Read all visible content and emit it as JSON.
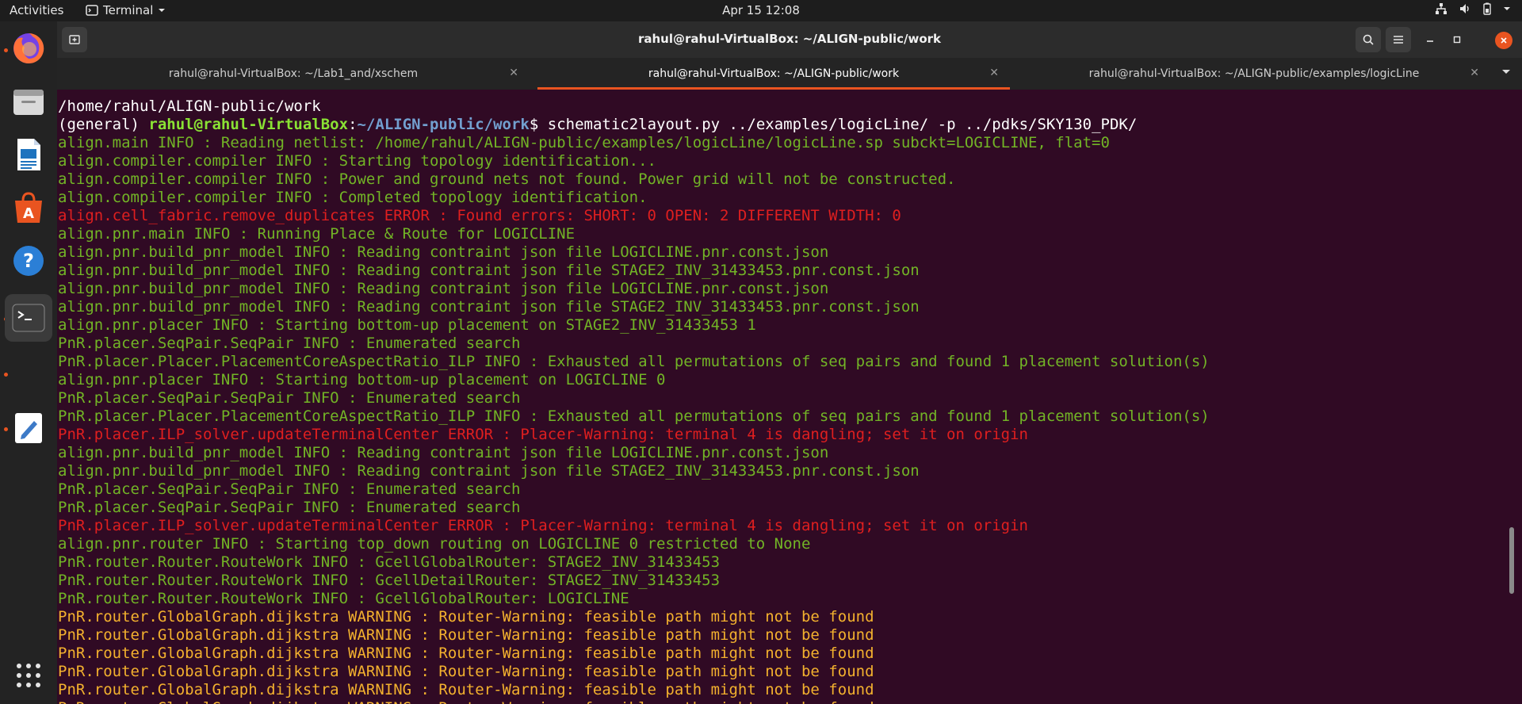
{
  "topbar": {
    "activities": "Activities",
    "app_name": "Terminal",
    "clock": "Apr 15  12:08"
  },
  "window": {
    "title": "rahul@rahul-VirtualBox: ~/ALIGN-public/work"
  },
  "tabs": [
    {
      "label": "rahul@rahul-VirtualBox: ~/Lab1_and/xschem",
      "active": false
    },
    {
      "label": "rahul@rahul-VirtualBox: ~/ALIGN-public/work",
      "active": true
    },
    {
      "label": "rahul@rahul-VirtualBox: ~/ALIGN-public/examples/logicLine",
      "active": false
    }
  ],
  "terminal": {
    "cwd_line": "/home/rahul/ALIGN-public/work",
    "prompt": {
      "env": "(general) ",
      "user_host": "rahul@rahul-VirtualBox",
      "sep": ":",
      "path": "~/ALIGN-public/work",
      "dollar": "$ ",
      "command": "schematic2layout.py ../examples/logicLine/ -p ../pdks/SKY130_PDK/"
    },
    "lines": [
      {
        "text": "align.main INFO : Reading netlist: /home/rahul/ALIGN-public/examples/logicLine/logicLine.sp subckt=LOGICLINE, flat=0",
        "level": "info"
      },
      {
        "text": "align.compiler.compiler INFO : Starting topology identification...",
        "level": "info"
      },
      {
        "text": "align.compiler.compiler INFO : Power and ground nets not found. Power grid will not be constructed.",
        "level": "info"
      },
      {
        "text": "align.compiler.compiler INFO : Completed topology identification.",
        "level": "info"
      },
      {
        "text": "align.cell_fabric.remove_duplicates ERROR : Found errors: SHORT: 0 OPEN: 2 DIFFERENT WIDTH: 0",
        "level": "error"
      },
      {
        "text": "align.pnr.main INFO : Running Place & Route for LOGICLINE",
        "level": "info"
      },
      {
        "text": "align.pnr.build_pnr_model INFO : Reading contraint json file LOGICLINE.pnr.const.json",
        "level": "info"
      },
      {
        "text": "align.pnr.build_pnr_model INFO : Reading contraint json file STAGE2_INV_31433453.pnr.const.json",
        "level": "info"
      },
      {
        "text": "align.pnr.build_pnr_model INFO : Reading contraint json file LOGICLINE.pnr.const.json",
        "level": "info"
      },
      {
        "text": "align.pnr.build_pnr_model INFO : Reading contraint json file STAGE2_INV_31433453.pnr.const.json",
        "level": "info"
      },
      {
        "text": "align.pnr.placer INFO : Starting bottom-up placement on STAGE2_INV_31433453 1",
        "level": "info"
      },
      {
        "text": "PnR.placer.SeqPair.SeqPair INFO : Enumerated search",
        "level": "info"
      },
      {
        "text": "PnR.placer.Placer.PlacementCoreAspectRatio_ILP INFO : Exhausted all permutations of seq pairs and found 1 placement solution(s)",
        "level": "info"
      },
      {
        "text": "align.pnr.placer INFO : Starting bottom-up placement on LOGICLINE 0",
        "level": "info"
      },
      {
        "text": "PnR.placer.SeqPair.SeqPair INFO : Enumerated search",
        "level": "info"
      },
      {
        "text": "PnR.placer.Placer.PlacementCoreAspectRatio_ILP INFO : Exhausted all permutations of seq pairs and found 1 placement solution(s)",
        "level": "info"
      },
      {
        "text": "PnR.placer.ILP_solver.updateTerminalCenter ERROR : Placer-Warning: terminal 4 is dangling; set it on origin",
        "level": "error"
      },
      {
        "text": "align.pnr.build_pnr_model INFO : Reading contraint json file LOGICLINE.pnr.const.json",
        "level": "info"
      },
      {
        "text": "align.pnr.build_pnr_model INFO : Reading contraint json file STAGE2_INV_31433453.pnr.const.json",
        "level": "info"
      },
      {
        "text": "PnR.placer.SeqPair.SeqPair INFO : Enumerated search",
        "level": "info"
      },
      {
        "text": "PnR.placer.SeqPair.SeqPair INFO : Enumerated search",
        "level": "info"
      },
      {
        "text": "PnR.placer.ILP_solver.updateTerminalCenter ERROR : Placer-Warning: terminal 4 is dangling; set it on origin",
        "level": "error"
      },
      {
        "text": "align.pnr.router INFO : Starting top_down routing on LOGICLINE 0 restricted to None",
        "level": "info"
      },
      {
        "text": "PnR.router.Router.RouteWork INFO : GcellGlobalRouter: STAGE2_INV_31433453",
        "level": "info"
      },
      {
        "text": "PnR.router.Router.RouteWork INFO : GcellDetailRouter: STAGE2_INV_31433453",
        "level": "info"
      },
      {
        "text": "PnR.router.Router.RouteWork INFO : GcellGlobalRouter: LOGICLINE",
        "level": "info"
      },
      {
        "text": "PnR.router.GlobalGraph.dijkstra WARNING : Router-Warning: feasible path might not be found",
        "level": "warn"
      },
      {
        "text": "PnR.router.GlobalGraph.dijkstra WARNING : Router-Warning: feasible path might not be found",
        "level": "warn"
      },
      {
        "text": "PnR.router.GlobalGraph.dijkstra WARNING : Router-Warning: feasible path might not be found",
        "level": "warn"
      },
      {
        "text": "PnR.router.GlobalGraph.dijkstra WARNING : Router-Warning: feasible path might not be found",
        "level": "warn"
      },
      {
        "text": "PnR.router.GlobalGraph.dijkstra WARNING : Router-Warning: feasible path might not be found",
        "level": "warn"
      },
      {
        "text": "PnR.router.GlobalGraph.dijkstra WARNING : Router-Warning: feasible path might not be found",
        "level": "warn"
      }
    ]
  },
  "colors": {
    "info": "#72b426",
    "error": "#df1f1f",
    "warn": "#f3b12e",
    "accent": "#e95420"
  },
  "dock": [
    {
      "name": "firefox-icon"
    },
    {
      "name": "files-icon"
    },
    {
      "name": "writer-icon"
    },
    {
      "name": "software-icon"
    },
    {
      "name": "help-icon"
    },
    {
      "name": "terminal-icon"
    },
    {
      "name": "text-editor-icon"
    },
    {
      "name": "app-grid-icon"
    }
  ]
}
